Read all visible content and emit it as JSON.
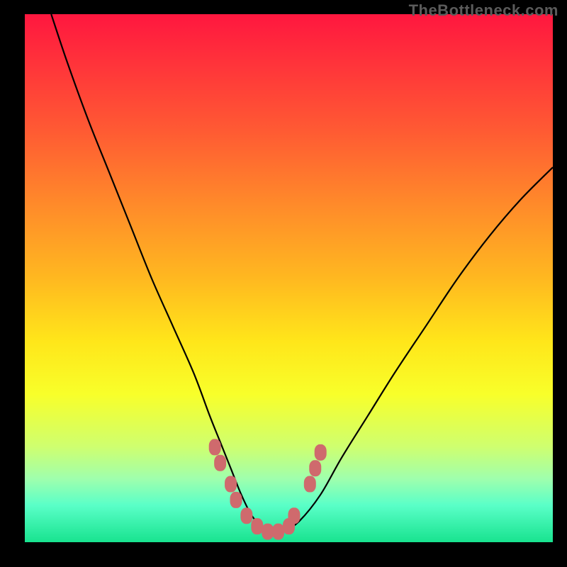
{
  "watermark": "TheBottleneck.com",
  "colors": {
    "curve": "#000000",
    "marker": "#cf6a6d",
    "marker_stroke": "#cf6a6d"
  },
  "chart_data": {
    "type": "line",
    "title": "",
    "xlabel": "",
    "ylabel": "",
    "xlim": [
      0,
      100
    ],
    "ylim": [
      0,
      100
    ],
    "grid": false,
    "legend": false,
    "series": [
      {
        "name": "bottleneck-curve",
        "x": [
          5,
          8,
          12,
          16,
          20,
          24,
          28,
          32,
          35,
          37,
          39,
          41,
          43,
          45,
          47,
          49,
          52,
          56,
          60,
          65,
          70,
          76,
          82,
          88,
          94,
          100
        ],
        "y": [
          100,
          91,
          80,
          70,
          60,
          50,
          41,
          32,
          24,
          19,
          14,
          9,
          5,
          3,
          2,
          2,
          4,
          9,
          16,
          24,
          32,
          41,
          50,
          58,
          65,
          71
        ]
      }
    ],
    "markers": [
      {
        "x": 36,
        "y": 18
      },
      {
        "x": 37,
        "y": 15
      },
      {
        "x": 39,
        "y": 11
      },
      {
        "x": 40,
        "y": 8
      },
      {
        "x": 42,
        "y": 5
      },
      {
        "x": 44,
        "y": 3
      },
      {
        "x": 46,
        "y": 2
      },
      {
        "x": 48,
        "y": 2
      },
      {
        "x": 50,
        "y": 3
      },
      {
        "x": 51,
        "y": 5
      },
      {
        "x": 54,
        "y": 11
      },
      {
        "x": 55,
        "y": 14
      },
      {
        "x": 56,
        "y": 17
      }
    ]
  }
}
